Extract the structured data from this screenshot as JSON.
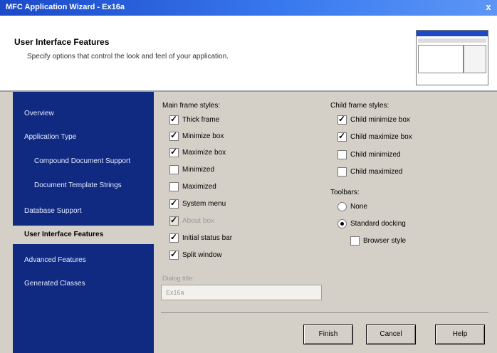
{
  "window": {
    "title": "MFC Application Wizard - Ex16a",
    "close_glyph": "x"
  },
  "header": {
    "title": "User Interface Features",
    "subtitle": "Specify options that control the look and feel of your application."
  },
  "sidebar": {
    "items": [
      {
        "label": "Overview"
      },
      {
        "label": "Application Type"
      },
      {
        "label": "Compound Document Support"
      },
      {
        "label": "Document Template Strings"
      },
      {
        "label": "Database Support"
      },
      {
        "label": "User Interface Features",
        "active": true
      },
      {
        "label": "Advanced Features"
      },
      {
        "label": "Generated Classes"
      }
    ]
  },
  "main_frame": {
    "label": "Main frame styles:",
    "options": [
      {
        "label": "Thick frame",
        "checked": true,
        "enabled": true
      },
      {
        "label": "Minimize box",
        "checked": true,
        "enabled": true
      },
      {
        "label": "Maximize box",
        "checked": true,
        "enabled": true
      },
      {
        "label": "Minimized",
        "checked": false,
        "enabled": true
      },
      {
        "label": "Maximized",
        "checked": false,
        "enabled": true
      },
      {
        "label": "System menu",
        "checked": true,
        "enabled": true
      },
      {
        "label": "About box",
        "checked": true,
        "enabled": false
      },
      {
        "label": "Initial status bar",
        "checked": true,
        "enabled": true
      },
      {
        "label": "Split window",
        "checked": true,
        "enabled": true
      }
    ]
  },
  "dialog_title": {
    "label": "Dialog title:",
    "value": "Ex16a"
  },
  "child_frame": {
    "label": "Child frame styles:",
    "options": [
      {
        "label": "Child minimize box",
        "checked": true
      },
      {
        "label": "Child maximize box",
        "checked": true
      },
      {
        "label": "Child minimized",
        "checked": false
      },
      {
        "label": "Child maximized",
        "checked": false
      }
    ]
  },
  "toolbars": {
    "label": "Toolbars:",
    "options": [
      {
        "label": "None",
        "selected": false
      },
      {
        "label": "Standard docking",
        "selected": true
      }
    ],
    "browser_style": {
      "label": "Browser style",
      "checked": false
    }
  },
  "buttons": {
    "finish": "Finish",
    "cancel": "Cancel",
    "help": "Help"
  }
}
